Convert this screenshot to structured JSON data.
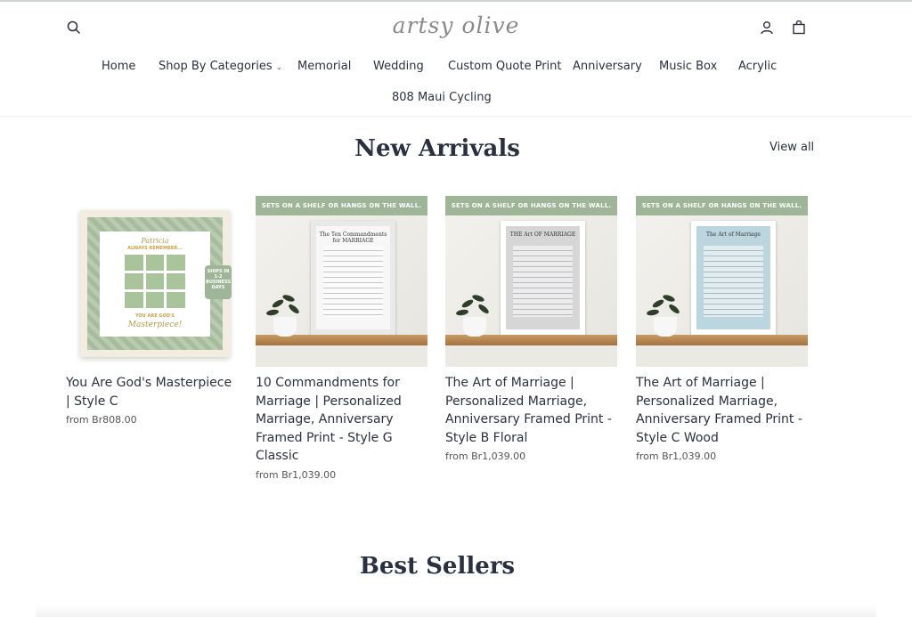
{
  "header": {
    "logo": "artsy olive",
    "nav": [
      "Home",
      "Shop By Categories",
      "Memorial",
      "Wedding",
      "Custom Quote Print",
      "Anniversary",
      "Music Box",
      "Acrylic",
      "808 Maui Cycling"
    ]
  },
  "sections": {
    "new_arrivals_title": "New Arrivals",
    "view_all": "View all",
    "best_sellers_title": "Best Sellers"
  },
  "products": [
    {
      "title": "You Are God's Masterpiece | Style C",
      "price": "from Br808.00",
      "image": {
        "name": "Patricia",
        "sub": "ALWAYS REMEMBER...",
        "foot": "YOU ARE GOD'S",
        "foot2": "Masterpiece!",
        "badge": "SHIPS IN 1-2 BUSINESS DAYS"
      }
    },
    {
      "title": "10 Commandments for Marriage | Personalized Marriage, Anniversary Framed Print - Style G Classic",
      "price": "from Br1,039.00",
      "image": {
        "banner": "SETS ON A SHELF OR HANGS ON THE WALL.",
        "doc_title": "The Ten Commandments for MARRIAGE",
        "doc_bg": "#e9e9e9"
      }
    },
    {
      "title": "The Art of Marriage | Personalized Marriage, Anniversary Framed Print - Style B Floral",
      "price": "from Br1,039.00",
      "image": {
        "banner": "SETS ON A SHELF OR HANGS ON THE WALL.",
        "doc_title": "THE Art OF MARRIAGE",
        "doc_bg": "#d6d6d6"
      }
    },
    {
      "title": "The Art of Marriage | Personalized Marriage, Anniversary Framed Print - Style C Wood",
      "price": "from Br1,039.00",
      "image": {
        "banner": "SETS ON A SHELF OR HANGS ON THE WALL.",
        "doc_title": "The Art of Marriage",
        "doc_bg": "#bcd6df"
      }
    }
  ],
  "colors": {
    "text": "#2b3040",
    "banner": "#9fb598",
    "shelf": "#b5854f"
  },
  "icons": {
    "search": "search-icon",
    "account": "account-icon",
    "cart": "cart-icon"
  }
}
